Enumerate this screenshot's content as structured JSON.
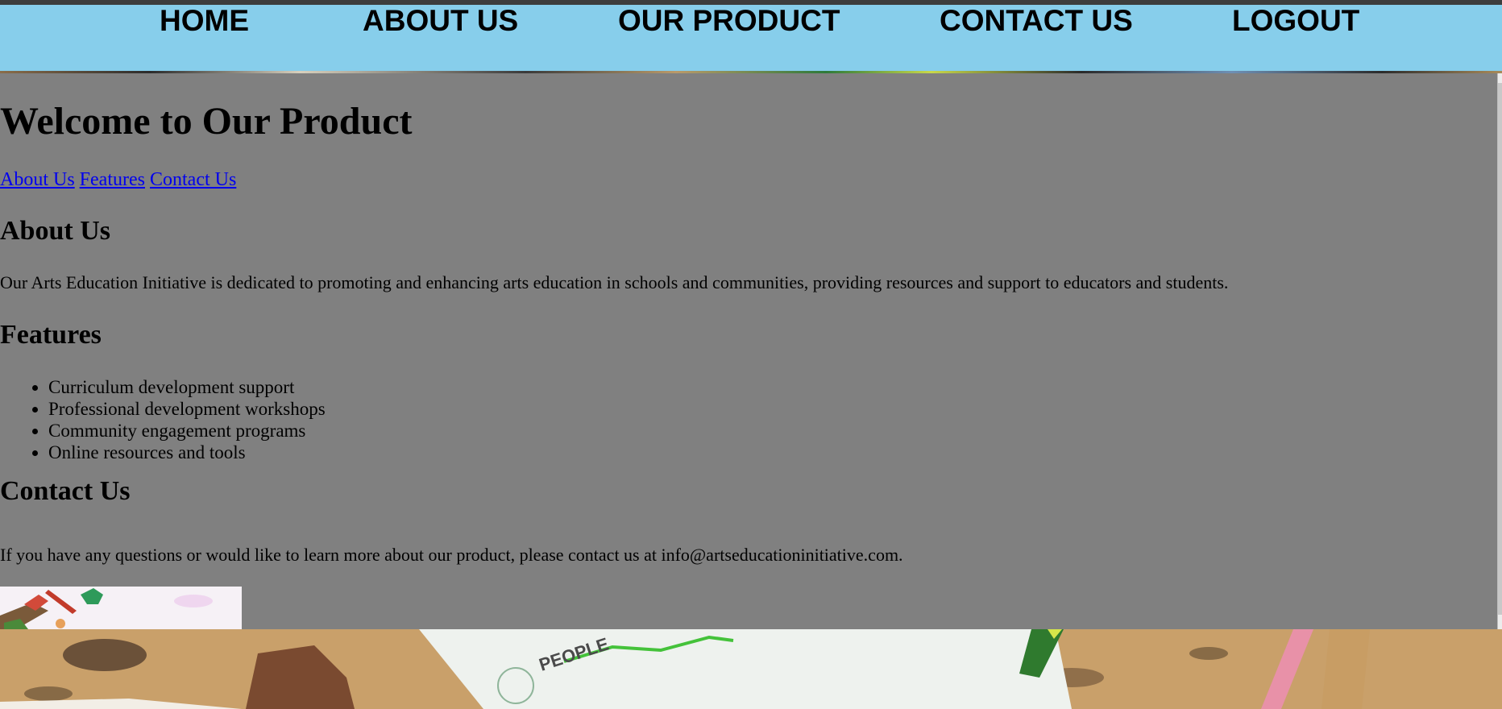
{
  "nav": {
    "items": [
      {
        "label": "HOME"
      },
      {
        "label": "ABOUT US"
      },
      {
        "label": "OUR PRODUCT"
      },
      {
        "label": "CONTACT US"
      },
      {
        "label": "LOGOUT"
      }
    ]
  },
  "page": {
    "title": "Welcome to Our Product",
    "links": [
      "About Us",
      "Features",
      "Contact Us"
    ],
    "about": {
      "heading": "About Us",
      "text": "Our Arts Education Initiative is dedicated to promoting and enhancing arts education in schools and communities, providing resources and support to educators and students."
    },
    "features": {
      "heading": "Features",
      "items": [
        "Curriculum development support",
        "Professional development workshops",
        "Community engagement programs",
        "Online resources and tools"
      ]
    },
    "contact": {
      "heading": "Contact Us",
      "text": "If you have any questions or would like to learn more about our product, please contact us at info@artseducationinitiative.com."
    }
  },
  "background": {
    "photo_text": "PEOPLE"
  },
  "colors": {
    "navbar": "#87ceeb",
    "panel": "#808080",
    "link": "#0000ee",
    "background_desk": "#c9a06a"
  }
}
